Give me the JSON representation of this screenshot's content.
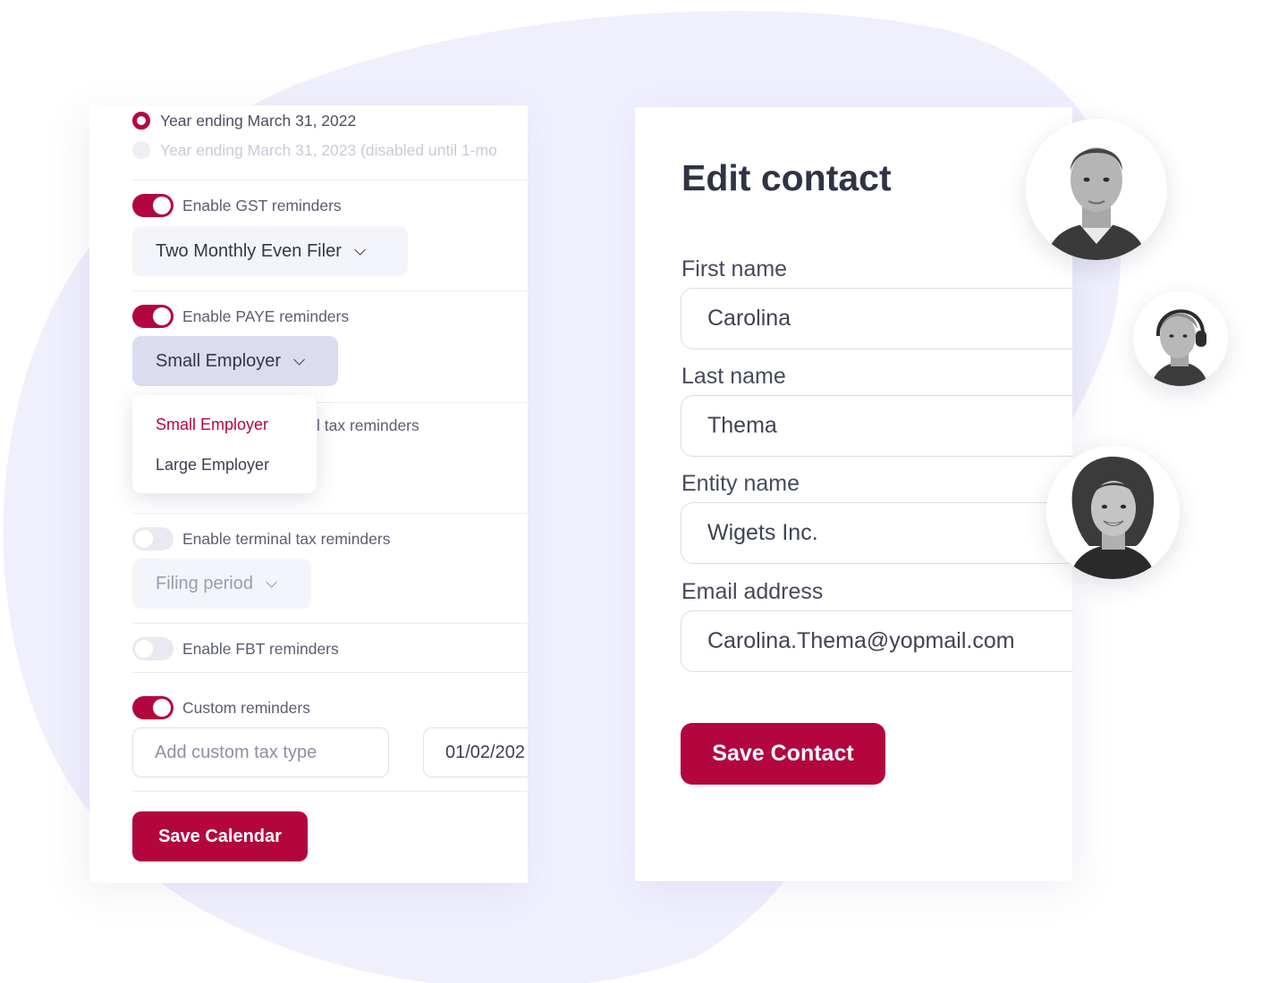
{
  "calendar": {
    "radios": [
      {
        "label": "Year ending March 31, 2022",
        "selected": true
      },
      {
        "label": "Year ending March 31, 2023 (disabled until 1-mo",
        "selected": false,
        "disabled": true
      }
    ],
    "gst": {
      "toggle_label": "Enable GST reminders",
      "enabled": true,
      "select_value": "Two Monthly Even Filer"
    },
    "paye": {
      "toggle_label": "Enable PAYE reminders",
      "enabled": true,
      "select_value": "Small Employer",
      "dropdown_options": [
        "Small Employer",
        "Large Employer"
      ],
      "behind_dropdown_text": "l tax reminders"
    },
    "terminal": {
      "toggle_label": "Enable terminal tax reminders",
      "enabled": false,
      "select_placeholder": "Filing period"
    },
    "fbt": {
      "toggle_label": "Enable FBT reminders",
      "enabled": false
    },
    "custom": {
      "toggle_label": "Custom reminders",
      "enabled": true,
      "tax_type_placeholder": "Add custom tax type",
      "date_value": "01/02/202"
    },
    "save_label": "Save Calendar"
  },
  "contact": {
    "title": "Edit contact",
    "fields": [
      {
        "label": "First name",
        "value": "Carolina"
      },
      {
        "label": "Last name",
        "value": "Thema"
      },
      {
        "label": "Entity name",
        "value": "Wigets Inc."
      },
      {
        "label": "Email address",
        "value": "Carolina.Thema@yopmail.com"
      }
    ],
    "save_label": "Save Contact"
  },
  "colors": {
    "accent": "#b3063f",
    "blob": "#efeffd",
    "select_active": "#dcdcf0"
  }
}
